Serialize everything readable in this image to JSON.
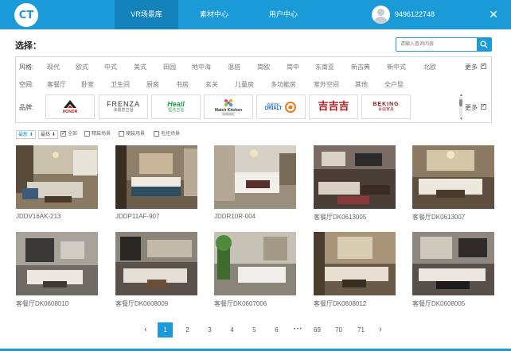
{
  "header": {
    "logo_text": "CT",
    "tabs": [
      {
        "label": "VR场景库",
        "active": true
      },
      {
        "label": "素材中心",
        "active": false
      },
      {
        "label": "用户中心",
        "active": false
      }
    ],
    "username": "9496122748",
    "close_symbol": "✕",
    "accent_color": "#1a9ad6"
  },
  "filters": {
    "select_label": "选择：",
    "search_placeholder": "请输入查询内容",
    "style_label": "风格:",
    "style_options": [
      "现代",
      "欧式",
      "中式",
      "美式",
      "田园",
      "地中海",
      "混搭",
      "简欧",
      "简中",
      "东南亚",
      "新古典",
      "新中式",
      "北欧"
    ],
    "space_label": "空间:",
    "space_options": [
      "客餐厅",
      "卧室",
      "卫生间",
      "厨房",
      "书房",
      "玄关",
      "儿童房",
      "多功能房",
      "室外空间",
      "其他",
      "全户型"
    ],
    "brand_label": "品牌:",
    "brands": [
      {
        "name": "HONOR",
        "icon": "honor-logo"
      },
      {
        "name": "FRENZA",
        "sub": "法恩莎卫浴",
        "icon": "frenza-logo"
      },
      {
        "name": "Heall",
        "sub": "恒洁卫浴",
        "icon": "heall-logo"
      },
      {
        "name": "Match Kitchen",
        "sub": "丽格橱柜",
        "icon": "match-kitchen-logo"
      },
      {
        "name": "ORIALT",
        "sub": "欧瑞涂料",
        "icon": "orialt-logo"
      },
      {
        "name": "吉吉吉",
        "icon": "chinese-brand-logo"
      },
      {
        "name": "BEKING",
        "sub": "百强家具",
        "icon": "beking-logo"
      }
    ],
    "more_label": "更多"
  },
  "sort_bar": {
    "newest": "最新",
    "hottest": "最热",
    "tags": [
      {
        "label": "全部",
        "checked": true
      },
      {
        "label": "精装场景",
        "checked": false
      },
      {
        "label": "硬装场景",
        "checked": false
      },
      {
        "label": "毛坯场景",
        "checked": false
      }
    ]
  },
  "gallery": [
    {
      "label": "JDDV16AK-213"
    },
    {
      "label": "JDDP11AF-907"
    },
    {
      "label": "JDDR10R-004"
    },
    {
      "label": "客餐厅DK0613005"
    },
    {
      "label": "客餐厅DK0613007"
    },
    {
      "label": "客餐厅DK0608010"
    },
    {
      "label": "客餐厅DK0608009"
    },
    {
      "label": "客餐厅DK0607006"
    },
    {
      "label": "客餐厅DK0608012"
    },
    {
      "label": "客餐厅DK0608005"
    }
  ],
  "pagination": {
    "prev": "‹",
    "next": "›",
    "pages": [
      "1",
      "2",
      "3",
      "4",
      "5",
      "6"
    ],
    "ellipsis": "• • •",
    "tail_pages": [
      "69",
      "70",
      "71"
    ],
    "current": "1"
  }
}
